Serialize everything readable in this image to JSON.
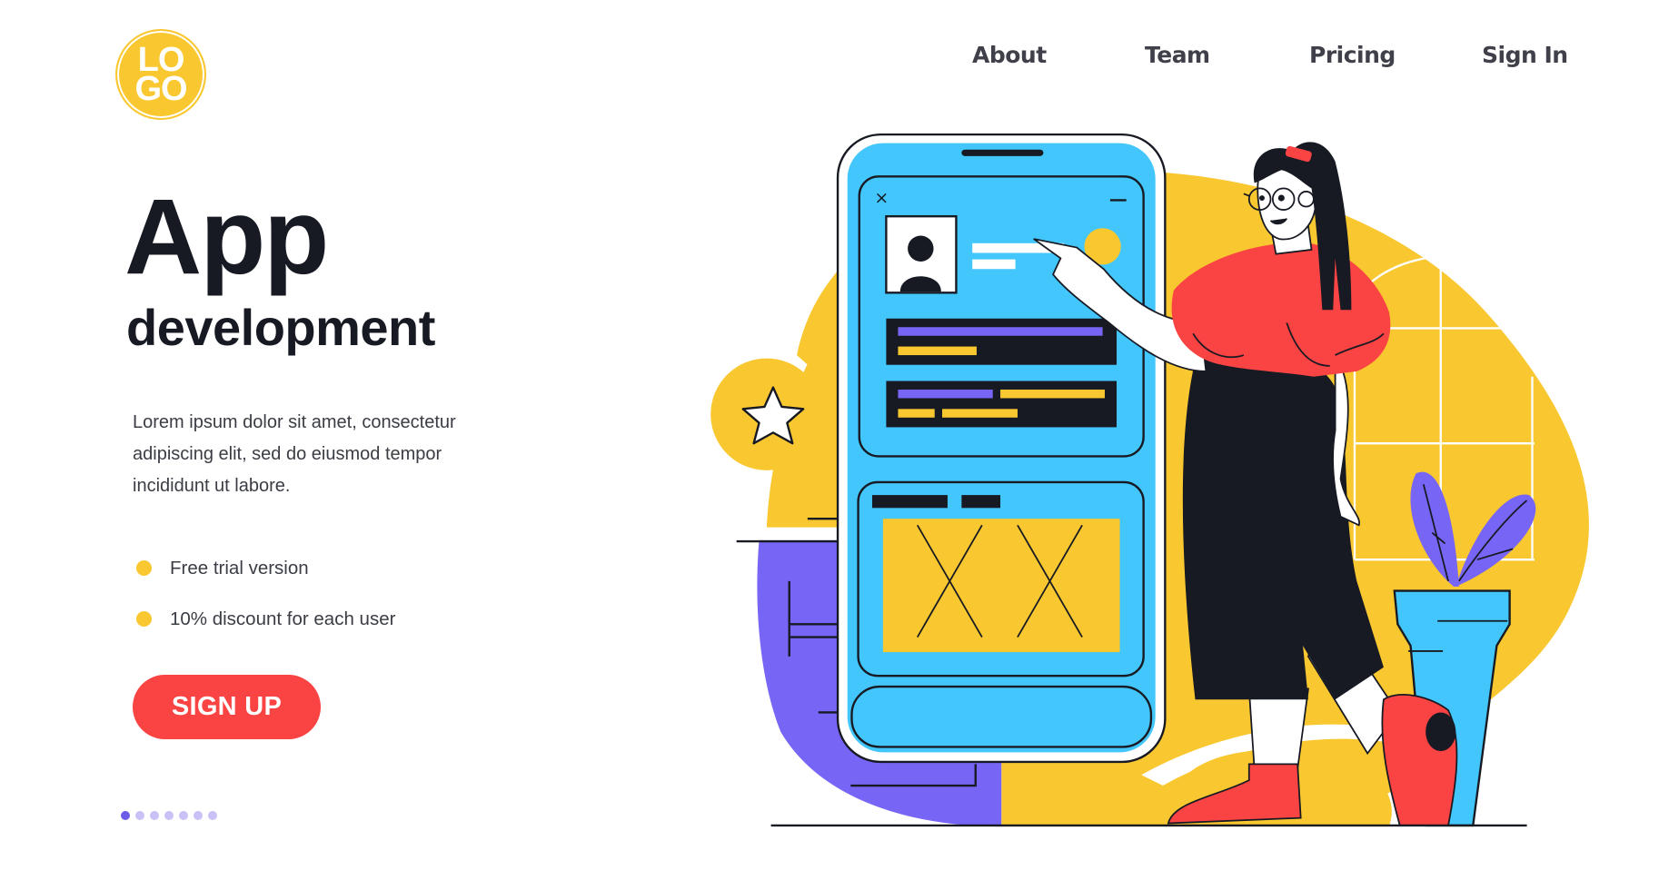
{
  "logo": {
    "line1": "LO",
    "line2": "GO"
  },
  "nav": {
    "items": [
      {
        "label": "About"
      },
      {
        "label": "Team"
      },
      {
        "label": "Pricing"
      },
      {
        "label": "Sign In"
      }
    ]
  },
  "hero": {
    "title": "App",
    "subtitle": "development",
    "description": "Lorem ipsum dolor sit amet, consectetur adipiscing elit, sed do eiusmod tempor incididunt ut labore.",
    "features": [
      {
        "text": "Free trial version"
      },
      {
        "text": "10% discount for each user"
      }
    ],
    "cta_label": "SIGN UP"
  },
  "pagination": {
    "total": 7,
    "active": 1
  },
  "illustration": {
    "subject": "woman pointing at large smartphone app wireframe",
    "phone_window_controls": {
      "close": "×",
      "minimize": "—"
    }
  },
  "colors": {
    "yellow": "#f9c72f",
    "red": "#fa4343",
    "blue": "#42c6fb",
    "purple": "#7766f6",
    "dark": "#171a23",
    "text": "#3b3d45"
  }
}
